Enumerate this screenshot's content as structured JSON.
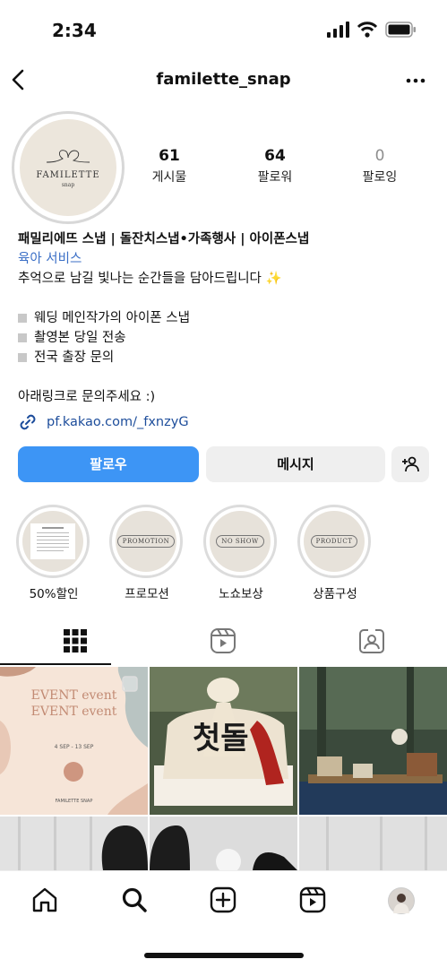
{
  "status_bar": {
    "time": "2:34"
  },
  "header": {
    "username": "familette_snap"
  },
  "profile": {
    "avatar": {
      "brand": "FAMILETTE",
      "brand_sub": "snap"
    },
    "stats": [
      {
        "value": "61",
        "label": "게시물"
      },
      {
        "value": "64",
        "label": "팔로워"
      },
      {
        "value": "0",
        "label": "팔로잉"
      }
    ],
    "bio": {
      "name": "패밀리에뜨 스냅 | 돌잔치스냅•가족행사 | 아이폰스냅",
      "category": "육아 서비스",
      "tagline": "추억으로 남길 빛나는 순간들을 담아드립니다 ✨",
      "bullets": [
        "웨딩 메인작가의 아이폰 스냅",
        "촬영본 당일 전송",
        "전국 출장 문의"
      ],
      "contact": "아래링크로 문의주세요 :)",
      "link": "pf.kakao.com/_fxnzyG"
    }
  },
  "buttons": {
    "follow": "팔로우",
    "message": "메시지"
  },
  "highlights": [
    {
      "label": "50%할인",
      "tag": ""
    },
    {
      "label": "프로모션",
      "tag": "PROMOTION"
    },
    {
      "label": "노쇼보상",
      "tag": "NO SHOW"
    },
    {
      "label": "상품구성",
      "tag": "PRODUCT"
    }
  ],
  "grid": {
    "post1": {
      "line1": "EVENT event",
      "line2": "EVENT event",
      "dates": "4 SEP - 13 SEP",
      "footer": "FAMILETTE SNAP"
    },
    "post2": {
      "calligraphy": "첫돌"
    }
  },
  "icons": [
    "back-arrow-icon",
    "more-icon",
    "link-icon",
    "add-person-icon",
    "grid-icon",
    "reels-icon",
    "tagged-icon",
    "home-icon",
    "search-icon",
    "create-icon",
    "reels-nav-icon"
  ]
}
